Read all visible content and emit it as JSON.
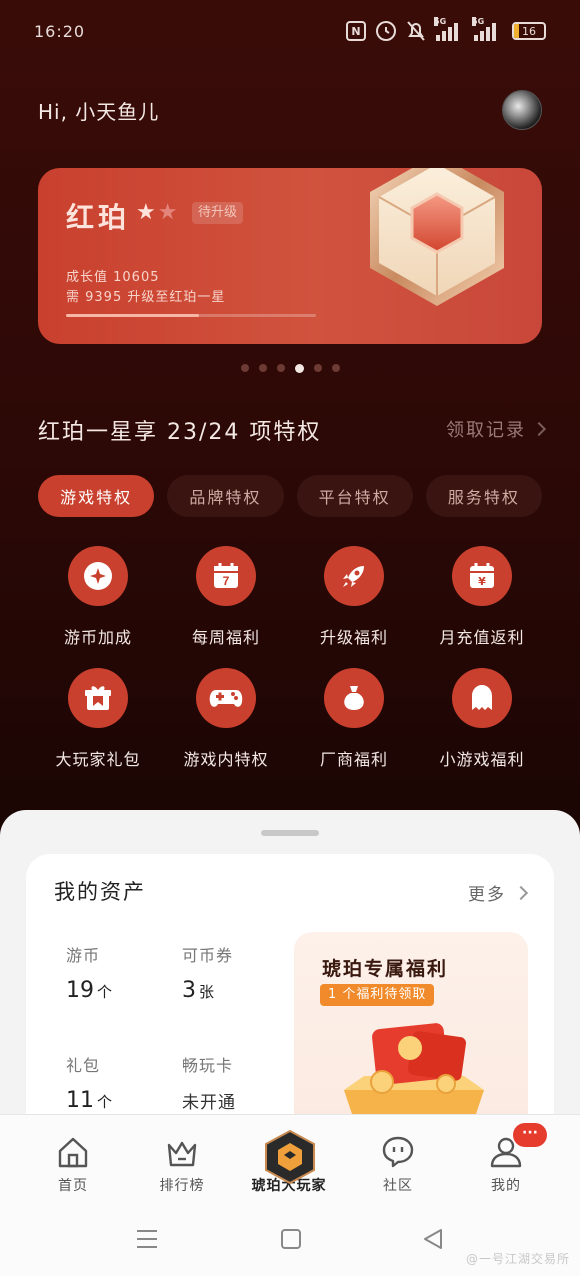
{
  "status_bar": {
    "time": "16:20",
    "network_1": "5G",
    "network_2": "5G",
    "battery": "16",
    "battery_level": 0.16,
    "icons": [
      "nfc-icon",
      "alarm-icon",
      "mute-icon",
      "signal-icon",
      "signal-icon",
      "battery-icon"
    ]
  },
  "greeting": "Hi, 小天鱼儿",
  "level_card": {
    "level_name": "红珀",
    "stars_filled": 1,
    "stars_total": 2,
    "status_badge": "待升级",
    "growth_value": "成长值 10605",
    "upgrade_hint": "需 9395 升级至红珀一星",
    "progress": 0.53,
    "emblem_icon": "amber-cube-emblem-icon"
  },
  "carousel": {
    "count": 6,
    "active_index": 3
  },
  "privileges": {
    "title": "红珀一星享 23/24 项特权",
    "record_link": "领取记录",
    "tabs": [
      {
        "label": "游戏特权",
        "active": true
      },
      {
        "label": "品牌特权",
        "active": false
      },
      {
        "label": "平台特权",
        "active": false
      },
      {
        "label": "服务特权",
        "active": false
      }
    ],
    "items": [
      {
        "label": "游币加成",
        "icon": "coin-star-icon"
      },
      {
        "label": "每周福利",
        "icon": "calendar-icon"
      },
      {
        "label": "升级福利",
        "icon": "rocket-icon"
      },
      {
        "label": "月充值返利",
        "icon": "calendar-yuan-icon"
      },
      {
        "label": "大玩家礼包",
        "icon": "gift-box-icon"
      },
      {
        "label": "游戏内特权",
        "icon": "gamepad-icon"
      },
      {
        "label": "厂商福利",
        "icon": "money-bag-icon"
      },
      {
        "label": "小游戏福利",
        "icon": "ghost-icon"
      }
    ]
  },
  "assets": {
    "title": "我的资产",
    "more": "更多",
    "items": [
      {
        "label": "游币",
        "value": "19",
        "unit": "个"
      },
      {
        "label": "可币券",
        "value": "3",
        "unit": "张"
      },
      {
        "label": "礼包",
        "value": "11",
        "unit": "个"
      },
      {
        "label": "畅玩卡",
        "value": "未开通",
        "unit": ""
      }
    ],
    "promo": {
      "title": "琥珀专属福利",
      "tag": "1 个福利待领取"
    }
  },
  "tabbar": {
    "items": [
      {
        "label": "首页",
        "icon": "home-icon"
      },
      {
        "label": "排行榜",
        "icon": "crown-icon"
      },
      {
        "label": "琥珀大玩家",
        "icon": "amber-logo-icon",
        "active": true
      },
      {
        "label": "社区",
        "icon": "chat-bubble-icon"
      },
      {
        "label": "我的",
        "icon": "user-icon",
        "badge": "···"
      }
    ]
  },
  "navbar": {
    "watermark": "@一号江湖交易所"
  },
  "colors": {
    "accent": "#c9402e",
    "background": "#2a0806",
    "sheet": "#f3f3f3"
  }
}
